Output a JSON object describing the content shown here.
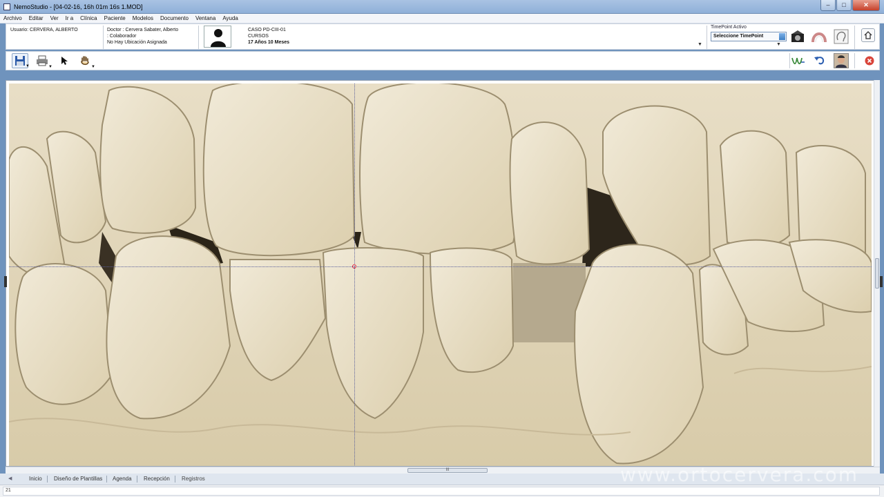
{
  "window": {
    "title": "NemoStudio - [04-02-16, 16h 01m 16s 1.MOD]"
  },
  "menu": [
    "Archivo",
    "Editar",
    "Ver",
    "Ir a",
    "Clínica",
    "Paciente",
    "Modelos",
    "Documento",
    "Ventana",
    "Ayuda"
  ],
  "info": {
    "user": "Usuario: CERVERA, ALBERTO",
    "doctor": "Doctor : Cervera Sabater, Alberto",
    "role": ": Colaborador",
    "location": "No Hay Ubicación Asignada",
    "case_id": "CASO PD-CIII-01",
    "course": "CURSOS",
    "age": "17 Años 10 Meses"
  },
  "timepoint": {
    "label": "TimePoint Activo",
    "value": "Seleccione TimePoint"
  },
  "icons": {
    "photo": "camera-icon",
    "model": "dental-arch-icon",
    "xray": "head-xray-icon",
    "home": "home-icon",
    "save": "save-icon",
    "print": "printer-icon",
    "select": "arrow-pointer-icon",
    "pan": "hand-pan-icon",
    "analysis": "tracing-icon",
    "undo": "undo-icon",
    "patient": "patient-photo-icon",
    "close": "close-icon"
  },
  "tabs": [
    "Inicio",
    "Diseño de Plantillas",
    "Agenda",
    "Recepción",
    "Registros"
  ],
  "watermark": "www.ortocervera.com",
  "status": {
    "text": "21"
  },
  "scroll": {
    "thumb_label": "III"
  },
  "colors": {
    "titlebar": "#a9c3e3",
    "cast": "#e3d8bf",
    "close": "#d9443a",
    "crosshair": "#5a5f9a"
  }
}
